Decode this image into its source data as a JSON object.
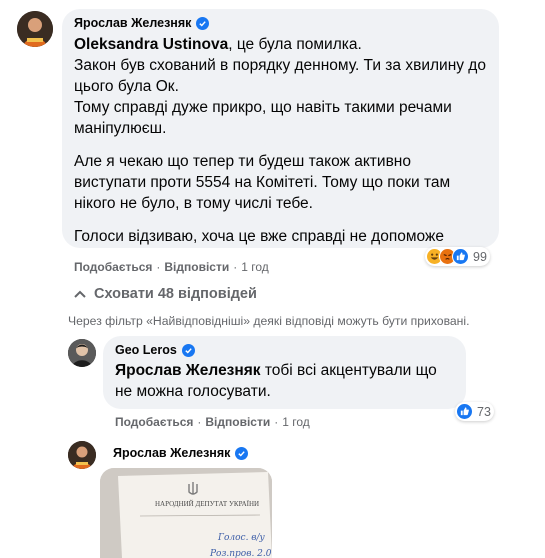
{
  "comment1": {
    "author": "Ярослав Железняк",
    "mention": "Oleksandra Ustinova",
    "mention_suffix": ", це була помилка.",
    "line_p1": "Закон був схований в порядку денному. Ти за хвилину до цього була Ок.",
    "line_p1b": "Тому справді дуже прикро, що навіть такими речами маніпулюєш.",
    "line_p2": "Але я чекаю що тепер ти будеш також активно виступати проти 5554 на Комітеті. Тому що поки там нікого не було, в тому числі тебе.",
    "line_p3": "Голоси відзиваю, хоча це вже справді не допоможе",
    "like": "Подобається",
    "reply": "Відповісти",
    "time": "1 год",
    "reaction_count": "99",
    "reactions": [
      "haha-icon",
      "angry-icon",
      "like-icon"
    ]
  },
  "hide_replies": {
    "label": "Сховати 48 відповідей"
  },
  "filter_notice": "Через фільтр «Найвідповідніші» деякі відповіді можуть бути приховані.",
  "reply1": {
    "author": "Geo Leros",
    "mention": "Ярослав Железняк",
    "text": " тобі всі акцентували що не можна голосувати.",
    "like": "Подобається",
    "reply": "Відповісти",
    "time": "1 год",
    "reaction_count": "73"
  },
  "reply2": {
    "author": "Ярослав Железняк",
    "doc_header": "НАРОДНИЙ ДЕПУТАТ УКРАЇНИ",
    "handwriting_1": "Голос. в/у",
    "handwriting_2": "Роз.пров. 2.0"
  },
  "colors": {
    "bubble": "#f0f2f5",
    "secondary_text": "#65676b",
    "verified": "#1877f2",
    "like": "#1877f2"
  }
}
